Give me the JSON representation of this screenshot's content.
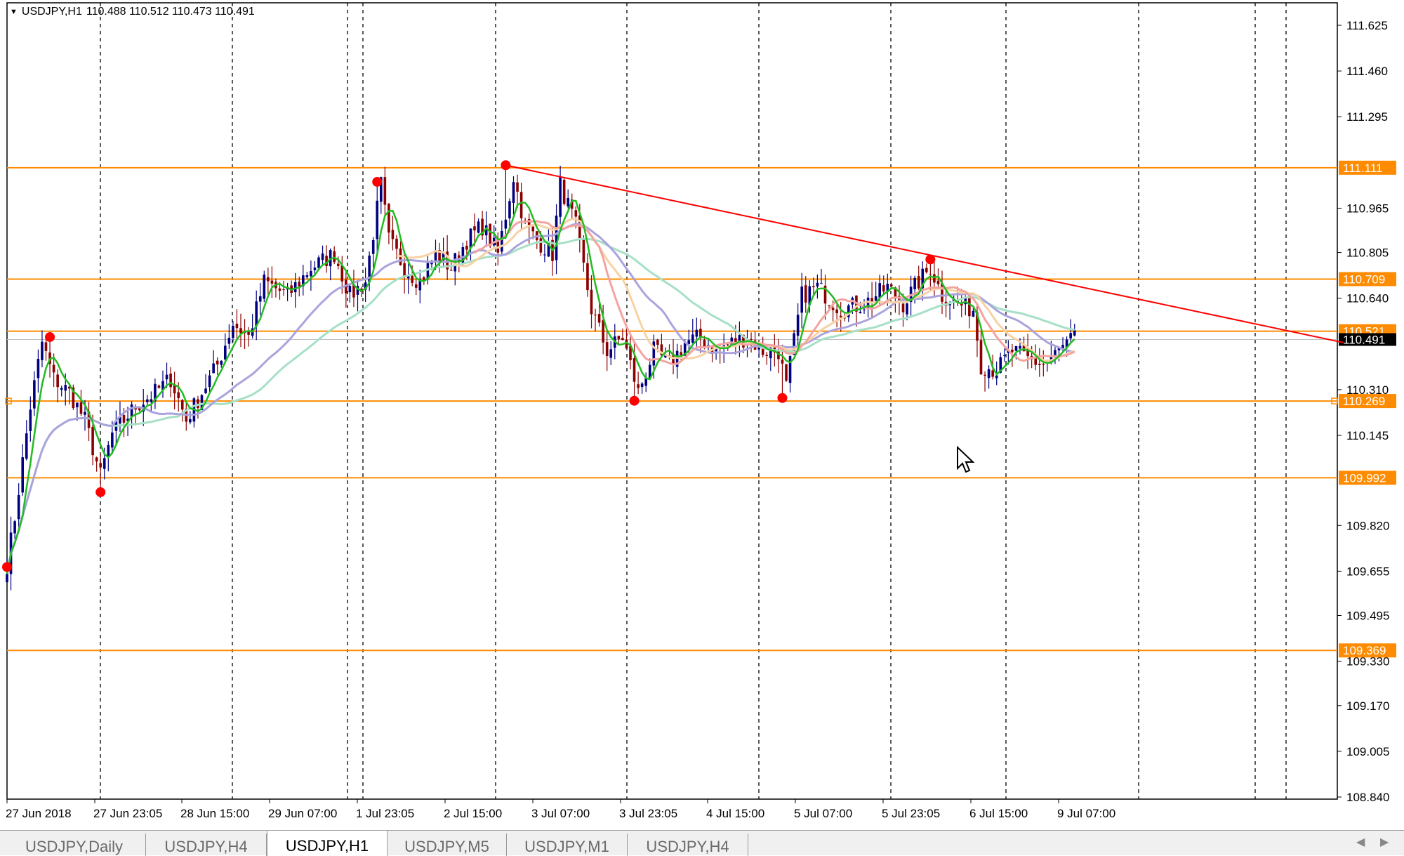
{
  "header": {
    "symbol": "USDJPY,H1",
    "ohlc": "110.488 110.512 110.473 110.491"
  },
  "tabs": [
    {
      "label": "USDJPY,Daily",
      "active": false
    },
    {
      "label": "USDJPY,H4",
      "active": false
    },
    {
      "label": "USDJPY,H1",
      "active": true
    },
    {
      "label": "USDJPY,M5",
      "active": false
    },
    {
      "label": "USDJPY,M1",
      "active": false
    },
    {
      "label": "USDJPY,H4",
      "active": false
    }
  ],
  "colors": {
    "bull": "#000080",
    "bear": "#8b0000",
    "level": "#ff8c00",
    "trend": "#ff0000",
    "pivot": "#ff0000",
    "ma_fast": "#22bb22",
    "ma_mid": "#aaa3dd",
    "ma_slow": "#a6e0c6",
    "ma_red": "#f4a4a0",
    "ma_orange": "#f8d2a4"
  },
  "chart_data": {
    "type": "candlestick",
    "symbol": "USDJPY",
    "timeframe": "H1",
    "y_ticks": [
      "111.625",
      "111.460",
      "111.295",
      "110.965",
      "110.805",
      "110.640",
      "110.310",
      "110.145",
      "109.820",
      "109.655",
      "109.495",
      "109.330",
      "109.170",
      "109.005",
      "108.840"
    ],
    "ylim": [
      108.84,
      111.7
    ],
    "x_labels": [
      "27 Jun 2018",
      "27 Jun 23:05",
      "28 Jun 15:00",
      "29 Jun 07:00",
      "1 Jul 23:05",
      "2 Jul 15:00",
      "3 Jul 07:00",
      "3 Jul 23:05",
      "4 Jul 15:00",
      "5 Jul 07:00",
      "5 Jul 23:05",
      "6 Jul 15:00",
      "9 Jul 07:00"
    ],
    "horizontal_levels": [
      "111.111",
      "110.709",
      "110.521",
      "110.269",
      "109.992",
      "109.369"
    ],
    "current_price": "110.491",
    "price_anchors": [
      [
        0,
        109.68
      ],
      [
        2,
        109.85
      ],
      [
        6,
        110.25
      ],
      [
        9,
        110.48
      ],
      [
        12,
        110.35
      ],
      [
        16,
        110.3
      ],
      [
        20,
        110.2
      ],
      [
        24,
        110.0
      ],
      [
        27,
        110.15
      ],
      [
        33,
        110.25
      ],
      [
        38,
        110.3
      ],
      [
        42,
        110.35
      ],
      [
        46,
        110.2
      ],
      [
        50,
        110.3
      ],
      [
        54,
        110.4
      ],
      [
        58,
        110.55
      ],
      [
        62,
        110.5
      ],
      [
        66,
        110.7
      ],
      [
        72,
        110.65
      ],
      [
        78,
        110.75
      ],
      [
        84,
        110.8
      ],
      [
        88,
        110.65
      ],
      [
        92,
        110.7
      ],
      [
        96,
        111.05
      ],
      [
        98,
        110.85
      ],
      [
        102,
        110.75
      ],
      [
        106,
        110.7
      ],
      [
        110,
        110.8
      ],
      [
        114,
        110.75
      ],
      [
        118,
        110.85
      ],
      [
        122,
        110.9
      ],
      [
        126,
        110.8
      ],
      [
        130,
        111.08
      ],
      [
        133,
        110.9
      ],
      [
        136,
        110.85
      ],
      [
        140,
        110.8
      ],
      [
        142,
        111.05
      ],
      [
        146,
        110.9
      ],
      [
        150,
        110.6
      ],
      [
        154,
        110.45
      ],
      [
        158,
        110.5
      ],
      [
        162,
        110.3
      ],
      [
        166,
        110.45
      ],
      [
        170,
        110.4
      ],
      [
        174,
        110.48
      ],
      [
        178,
        110.5
      ],
      [
        182,
        110.45
      ],
      [
        186,
        110.48
      ],
      [
        190,
        110.5
      ],
      [
        194,
        110.45
      ],
      [
        198,
        110.45
      ],
      [
        200,
        110.32
      ],
      [
        204,
        110.65
      ],
      [
        208,
        110.68
      ],
      [
        214,
        110.6
      ],
      [
        220,
        110.62
      ],
      [
        226,
        110.68
      ],
      [
        230,
        110.62
      ],
      [
        234,
        110.7
      ],
      [
        237,
        110.75
      ],
      [
        240,
        110.65
      ],
      [
        244,
        110.62
      ],
      [
        248,
        110.6
      ],
      [
        250,
        110.4
      ],
      [
        254,
        110.38
      ],
      [
        258,
        110.45
      ],
      [
        262,
        110.42
      ],
      [
        266,
        110.4
      ],
      [
        270,
        110.45
      ],
      [
        274,
        110.5
      ]
    ],
    "pivots": [
      {
        "type": "low",
        "bar": 0,
        "price": 109.67
      },
      {
        "type": "high",
        "bar": 11,
        "price": 110.5
      },
      {
        "type": "low",
        "bar": 24,
        "price": 109.94
      },
      {
        "type": "high",
        "bar": 95,
        "price": 111.06
      },
      {
        "type": "high",
        "bar": 128,
        "price": 111.12
      },
      {
        "type": "low",
        "bar": 161,
        "price": 110.27
      },
      {
        "type": "low",
        "bar": 199,
        "price": 110.28
      },
      {
        "type": "high",
        "bar": 237,
        "price": 110.78
      }
    ],
    "trendline": {
      "start": {
        "bar": 128,
        "price": 111.12
      },
      "end": {
        "bar": 343,
        "price": 110.48
      }
    },
    "moving_averages": [
      "fast",
      "medium",
      "slow",
      "red",
      "orange"
    ]
  }
}
